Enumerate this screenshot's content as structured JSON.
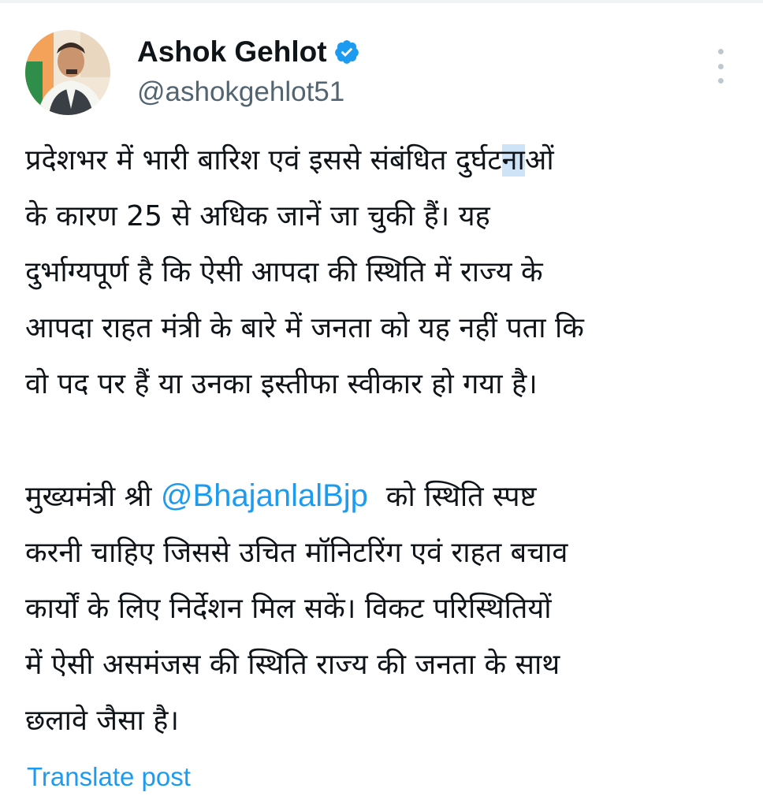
{
  "tweet": {
    "author": {
      "display_name": "Ashok Gehlot",
      "handle": "@ashokgehlot51",
      "verified": true,
      "avatar_icon": "profile-photo"
    },
    "body": {
      "line_1_before": "प्रदेशभर में भारी बारिश एवं इससे संबंधित दुर्घट",
      "line_1_highlight": "ना",
      "line_1_after": "ओं",
      "line_2": "के कारण 25 से अधिक जानें जा चुकी हैं। यह",
      "line_3": "दुर्भाग्यपूर्ण है कि ऐसी आपदा की स्थिति में राज्य के",
      "line_4": "आपदा राहत मंत्री के बारे में जनता को यह नहीं पता कि",
      "line_5": "वो पद पर हैं या उनका इस्तीफा स्वीकार हो गया है।",
      "line_6_before": "मुख्यमंत्री श्री ",
      "mention": "@BhajanlalBjp",
      "line_6_after": "  को स्थिति स्पष्ट",
      "line_7": "करनी चाहिए जिससे उचित मॉनिटरिंग एवं राहत बचाव",
      "line_8": "कार्यों के लिए निर्देशन मिल सकें। विकट परिस्थितियों",
      "line_9": "में ऐसी असमंजस की स्थिति राज्य की जनता के साथ",
      "line_10": "छलावे जैसा है।"
    },
    "translate_label": "Translate post"
  },
  "colors": {
    "link": "#1d9bf0",
    "secondary_text": "#536471",
    "primary_text": "#0f1419",
    "highlight": "#cde3f8",
    "verified_badge": "#1d9bf0"
  },
  "icons": {
    "verified": "verified-badge-icon",
    "more": "more-vertical-icon"
  }
}
